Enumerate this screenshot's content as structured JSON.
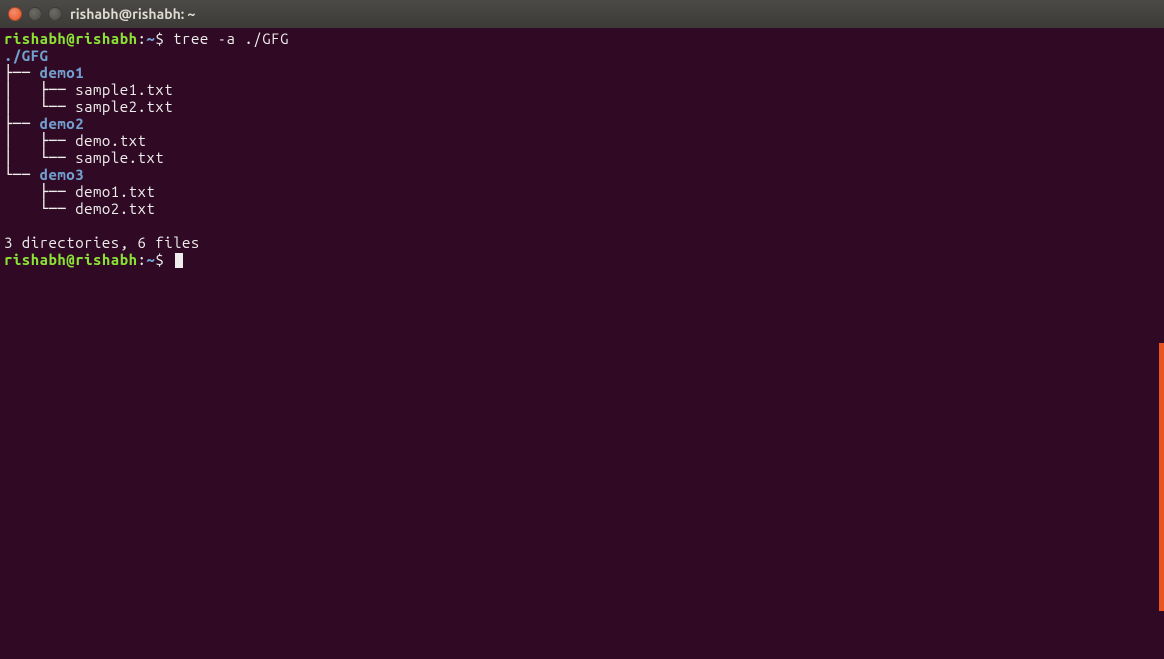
{
  "title_bar": {
    "title": "rishabh@rishabh: ~"
  },
  "prompt1": {
    "user_host": "rishabh@rishabh",
    "colon": ":",
    "path": "~",
    "dollar": "$ ",
    "command": "tree -a ./GFG"
  },
  "tree": {
    "root": "./GFG",
    "d1_prefix": "├── ",
    "d1_name": "demo1",
    "d1_f1_prefix": "│   ├── ",
    "d1_f1_name": "sample1.txt",
    "d1_f2_prefix": "│   └── ",
    "d1_f2_name": "sample2.txt",
    "d2_prefix": "├── ",
    "d2_name": "demo2",
    "d2_f1_prefix": "│   ├── ",
    "d2_f1_name": "demo.txt",
    "d2_f2_prefix": "│   └── ",
    "d2_f2_name": "sample.txt",
    "d3_prefix": "└── ",
    "d3_name": "demo3",
    "d3_f1_prefix": "    ├── ",
    "d3_f1_name": "demo1.txt",
    "d3_f2_prefix": "    └── ",
    "d3_f2_name": "demo2.txt"
  },
  "blank": "",
  "summary": "3 directories, 6 files",
  "prompt2": {
    "user_host": "rishabh@rishabh",
    "colon": ":",
    "path": "~",
    "dollar": "$ "
  }
}
